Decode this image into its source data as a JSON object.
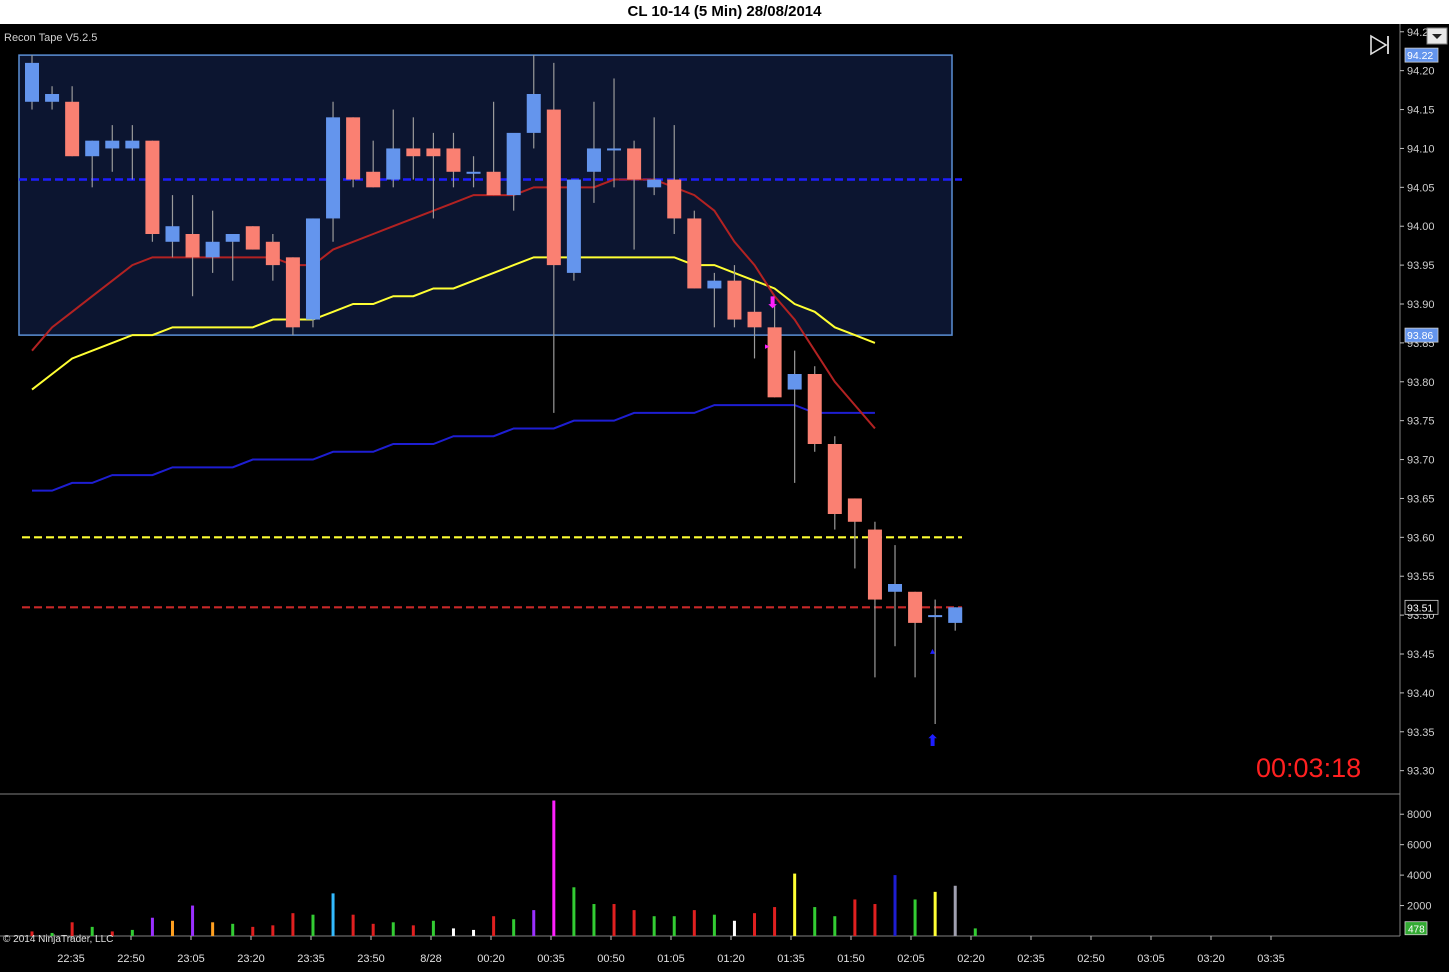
{
  "window_title": "CL 10-14 (5 Min)  28/08/2014",
  "indicator_label": "Recon Tape V5.2.5",
  "copyright": "© 2014 NinjaTrader, LLC",
  "timer": "00:03:18",
  "colors": {
    "background": "#000000",
    "up_candle": "#6495ed",
    "down_candle": "#fa8072",
    "range_box": "#0c1530",
    "range_border": "#5b8fd6",
    "ema_red": "#b22222",
    "ema_yellow": "#ffff33",
    "sma_blue": "#1e1ed2",
    "timer": "#ff2020"
  },
  "chart_data": {
    "type": "candlestick",
    "instrument": "CL 10-14",
    "interval": "5 Min",
    "date": "28/08/2014",
    "ylim": [
      93.27,
      94.26
    ],
    "y_ticks": [
      "94.25",
      "94.20",
      "94.15",
      "94.10",
      "94.05",
      "94.00",
      "93.95",
      "93.90",
      "93.85",
      "93.80",
      "93.75",
      "93.70",
      "93.65",
      "93.60",
      "93.55",
      "93.50",
      "93.45",
      "93.40",
      "93.35",
      "93.30"
    ],
    "x_ticks": [
      "22:35",
      "22:50",
      "23:05",
      "23:20",
      "23:35",
      "23:50",
      "8/28",
      "00:20",
      "00:35",
      "00:50",
      "01:05",
      "01:20",
      "01:35",
      "01:50",
      "02:05",
      "02:20",
      "02:35",
      "02:50",
      "03:05",
      "03:20",
      "03:35"
    ],
    "price_markers": [
      {
        "label": "94.22",
        "value": 94.22,
        "color": "#6495ed"
      },
      {
        "label": "93.86",
        "value": 93.86,
        "color": "#6495ed"
      },
      {
        "label": "93.51",
        "value": 93.51,
        "color": "#000000"
      }
    ],
    "range_box": {
      "high": 94.22,
      "low": 93.86,
      "mid": 94.06
    },
    "levels": [
      {
        "value": 93.6,
        "color": "#ffff33",
        "style": "dashed"
      },
      {
        "value": 93.51,
        "color": "#c82828",
        "style": "dashed"
      }
    ],
    "candles": [
      {
        "o": 94.16,
        "h": 94.22,
        "l": 94.15,
        "c": 94.21
      },
      {
        "o": 94.16,
        "h": 94.18,
        "l": 94.15,
        "c": 94.17
      },
      {
        "o": 94.16,
        "h": 94.18,
        "l": 94.09,
        "c": 94.09
      },
      {
        "o": 94.09,
        "h": 94.11,
        "l": 94.05,
        "c": 94.11
      },
      {
        "o": 94.1,
        "h": 94.13,
        "l": 94.07,
        "c": 94.11
      },
      {
        "o": 94.1,
        "h": 94.13,
        "l": 94.06,
        "c": 94.11
      },
      {
        "o": 94.11,
        "h": 94.11,
        "l": 93.98,
        "c": 93.99
      },
      {
        "o": 93.98,
        "h": 94.04,
        "l": 93.96,
        "c": 94.0
      },
      {
        "o": 93.99,
        "h": 94.04,
        "l": 93.91,
        "c": 93.96
      },
      {
        "o": 93.96,
        "h": 94.02,
        "l": 93.94,
        "c": 93.98
      },
      {
        "o": 93.98,
        "h": 93.99,
        "l": 93.93,
        "c": 93.99
      },
      {
        "o": 94.0,
        "h": 94.0,
        "l": 93.97,
        "c": 93.97
      },
      {
        "o": 93.98,
        "h": 93.99,
        "l": 93.93,
        "c": 93.95
      },
      {
        "o": 93.96,
        "h": 93.96,
        "l": 93.86,
        "c": 93.87
      },
      {
        "o": 93.88,
        "h": 94.01,
        "l": 93.87,
        "c": 94.01
      },
      {
        "o": 94.01,
        "h": 94.16,
        "l": 93.98,
        "c": 94.14
      },
      {
        "o": 94.14,
        "h": 94.14,
        "l": 94.05,
        "c": 94.06
      },
      {
        "o": 94.07,
        "h": 94.11,
        "l": 94.05,
        "c": 94.05
      },
      {
        "o": 94.06,
        "h": 94.15,
        "l": 94.05,
        "c": 94.1
      },
      {
        "o": 94.1,
        "h": 94.14,
        "l": 94.06,
        "c": 94.09
      },
      {
        "o": 94.1,
        "h": 94.12,
        "l": 94.01,
        "c": 94.09
      },
      {
        "o": 94.1,
        "h": 94.12,
        "l": 94.05,
        "c": 94.07
      },
      {
        "o": 94.07,
        "h": 94.09,
        "l": 94.05,
        "c": 94.07
      },
      {
        "o": 94.07,
        "h": 94.16,
        "l": 94.04,
        "c": 94.04
      },
      {
        "o": 94.04,
        "h": 94.1,
        "l": 94.02,
        "c": 94.12
      },
      {
        "o": 94.12,
        "h": 94.22,
        "l": 94.1,
        "c": 94.17
      },
      {
        "o": 94.15,
        "h": 94.21,
        "l": 93.76,
        "c": 93.95
      },
      {
        "o": 93.94,
        "h": 94.06,
        "l": 93.93,
        "c": 94.06
      },
      {
        "o": 94.07,
        "h": 94.16,
        "l": 94.03,
        "c": 94.1
      },
      {
        "o": 94.1,
        "h": 94.19,
        "l": 94.05,
        "c": 94.1
      },
      {
        "o": 94.1,
        "h": 94.11,
        "l": 93.97,
        "c": 94.06
      },
      {
        "o": 94.05,
        "h": 94.14,
        "l": 94.04,
        "c": 94.06
      },
      {
        "o": 94.06,
        "h": 94.13,
        "l": 93.99,
        "c": 94.01
      },
      {
        "o": 94.01,
        "h": 94.02,
        "l": 93.92,
        "c": 93.92
      },
      {
        "o": 93.92,
        "h": 93.94,
        "l": 93.87,
        "c": 93.93
      },
      {
        "o": 93.93,
        "h": 93.95,
        "l": 93.87,
        "c": 93.88
      },
      {
        "o": 93.89,
        "h": 93.93,
        "l": 93.83,
        "c": 93.87
      },
      {
        "o": 93.87,
        "h": 93.9,
        "l": 93.78,
        "c": 93.78
      },
      {
        "o": 93.79,
        "h": 93.84,
        "l": 93.67,
        "c": 93.81
      },
      {
        "o": 93.81,
        "h": 93.82,
        "l": 93.71,
        "c": 93.72
      },
      {
        "o": 93.72,
        "h": 93.73,
        "l": 93.61,
        "c": 93.63
      },
      {
        "o": 93.65,
        "h": 93.65,
        "l": 93.56,
        "c": 93.62
      },
      {
        "o": 93.61,
        "h": 93.62,
        "l": 93.42,
        "c": 93.52
      },
      {
        "o": 93.53,
        "h": 93.59,
        "l": 93.46,
        "c": 93.54
      },
      {
        "o": 93.53,
        "h": 93.53,
        "l": 93.42,
        "c": 93.49
      },
      {
        "o": 93.5,
        "h": 93.52,
        "l": 93.36,
        "c": 93.5
      },
      {
        "o": 93.49,
        "h": 93.51,
        "l": 93.48,
        "c": 93.51
      }
    ],
    "ema_red": [
      93.84,
      93.87,
      93.89,
      93.91,
      93.93,
      93.95,
      93.96,
      93.96,
      93.96,
      93.96,
      93.96,
      93.96,
      93.96,
      93.95,
      93.95,
      93.97,
      93.98,
      93.99,
      94.0,
      94.01,
      94.02,
      94.03,
      94.04,
      94.04,
      94.04,
      94.05,
      94.05,
      94.05,
      94.05,
      94.06,
      94.06,
      94.06,
      94.05,
      94.04,
      94.02,
      93.98,
      93.95,
      93.91,
      93.88,
      93.84,
      93.8,
      93.77,
      93.74
    ],
    "ema_yellow": [
      93.79,
      93.81,
      93.83,
      93.84,
      93.85,
      93.86,
      93.86,
      93.87,
      93.87,
      93.87,
      93.87,
      93.87,
      93.88,
      93.88,
      93.88,
      93.89,
      93.9,
      93.9,
      93.91,
      93.91,
      93.92,
      93.92,
      93.93,
      93.94,
      93.95,
      93.96,
      93.96,
      93.96,
      93.96,
      93.96,
      93.96,
      93.96,
      93.96,
      93.95,
      93.95,
      93.94,
      93.93,
      93.92,
      93.9,
      93.89,
      93.87,
      93.86,
      93.85
    ],
    "sma_blue": [
      93.66,
      93.66,
      93.67,
      93.67,
      93.68,
      93.68,
      93.68,
      93.69,
      93.69,
      93.69,
      93.69,
      93.7,
      93.7,
      93.7,
      93.7,
      93.71,
      93.71,
      93.71,
      93.72,
      93.72,
      93.72,
      93.73,
      93.73,
      93.73,
      93.74,
      93.74,
      93.74,
      93.75,
      93.75,
      93.75,
      93.76,
      93.76,
      93.76,
      93.76,
      93.77,
      93.77,
      93.77,
      93.77,
      93.77,
      93.76,
      93.76,
      93.76,
      93.76
    ],
    "volume": {
      "ylim": [
        0,
        9000
      ],
      "y_ticks": [
        "8000",
        "6000",
        "4000",
        "2000"
      ],
      "current_label": "478",
      "bars": [
        {
          "v": 300,
          "c": "#e02020"
        },
        {
          "v": 200,
          "c": "#33cc33"
        },
        {
          "v": 900,
          "c": "#e02020"
        },
        {
          "v": 600,
          "c": "#33cc33"
        },
        {
          "v": 300,
          "c": "#e02020"
        },
        {
          "v": 400,
          "c": "#33cc33"
        },
        {
          "v": 1200,
          "c": "#9b30ff"
        },
        {
          "v": 1000,
          "c": "#ffa020"
        },
        {
          "v": 2000,
          "c": "#9b30ff"
        },
        {
          "v": 900,
          "c": "#ffa020"
        },
        {
          "v": 800,
          "c": "#33cc33"
        },
        {
          "v": 600,
          "c": "#e02020"
        },
        {
          "v": 700,
          "c": "#e02020"
        },
        {
          "v": 1500,
          "c": "#e02020"
        },
        {
          "v": 1400,
          "c": "#33cc33"
        },
        {
          "v": 2800,
          "c": "#33bbff"
        },
        {
          "v": 1400,
          "c": "#e02020"
        },
        {
          "v": 800,
          "c": "#e02020"
        },
        {
          "v": 900,
          "c": "#33cc33"
        },
        {
          "v": 700,
          "c": "#e02020"
        },
        {
          "v": 1000,
          "c": "#33cc33"
        },
        {
          "v": 500,
          "c": "#ffffff"
        },
        {
          "v": 400,
          "c": "#ffffff"
        },
        {
          "v": 1300,
          "c": "#e02020"
        },
        {
          "v": 1100,
          "c": "#33cc33"
        },
        {
          "v": 1700,
          "c": "#9b30ff"
        },
        {
          "v": 8900,
          "c": "#ff20ff"
        },
        {
          "v": 3200,
          "c": "#33cc33"
        },
        {
          "v": 2100,
          "c": "#33cc33"
        },
        {
          "v": 2100,
          "c": "#e02020"
        },
        {
          "v": 1700,
          "c": "#e02020"
        },
        {
          "v": 1300,
          "c": "#33cc33"
        },
        {
          "v": 1300,
          "c": "#33cc33"
        },
        {
          "v": 1700,
          "c": "#e02020"
        },
        {
          "v": 1400,
          "c": "#33cc33"
        },
        {
          "v": 1000,
          "c": "#ffffff"
        },
        {
          "v": 1500,
          "c": "#e02020"
        },
        {
          "v": 1900,
          "c": "#e02020"
        },
        {
          "v": 4100,
          "c": "#ffff33"
        },
        {
          "v": 1900,
          "c": "#33cc33"
        },
        {
          "v": 1300,
          "c": "#33cc33"
        },
        {
          "v": 2400,
          "c": "#e02020"
        },
        {
          "v": 2100,
          "c": "#e02020"
        },
        {
          "v": 4000,
          "c": "#1e1ed2"
        },
        {
          "v": 2400,
          "c": "#33cc33"
        },
        {
          "v": 2900,
          "c": "#ffff33"
        },
        {
          "v": 3300,
          "c": "#a0a0b0"
        },
        {
          "v": 500,
          "c": "#33cc33"
        }
      ]
    }
  }
}
